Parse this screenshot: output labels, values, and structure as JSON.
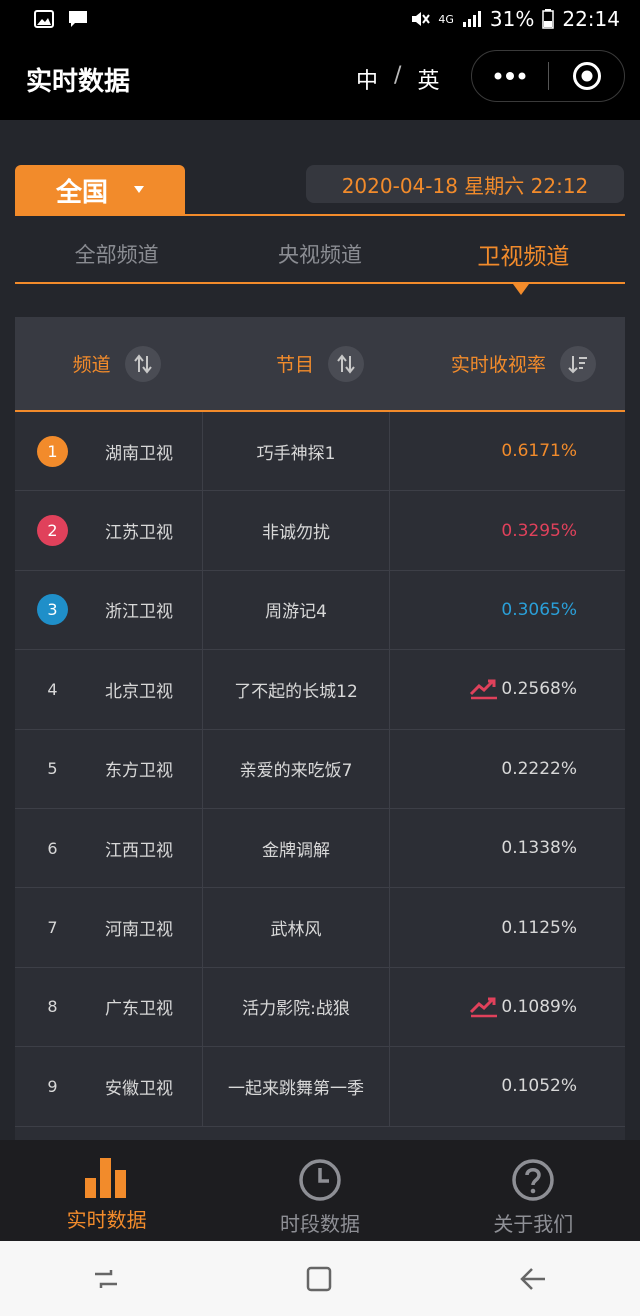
{
  "status_bar": {
    "network": "4G",
    "battery": "31%",
    "time": "22:14"
  },
  "header": {
    "title": "实时数据",
    "lang_zh": "中",
    "lang_sep": "/",
    "lang_en": "英"
  },
  "region": "全国",
  "datetime": "2020-04-18 星期六 22:12",
  "tabs": [
    {
      "label": "全部频道",
      "active": false
    },
    {
      "label": "央视频道",
      "active": false
    },
    {
      "label": "卫视频道",
      "active": true
    }
  ],
  "table": {
    "headers": [
      "频道",
      "节目",
      "实时收视率"
    ],
    "rows": [
      {
        "rank": "1",
        "channel": "湖南卫视",
        "program": "巧手神探1",
        "rate": "0.6171%",
        "rank_color": "#f28b2b",
        "rate_color": "#f28b2b",
        "trend": false
      },
      {
        "rank": "2",
        "channel": "江苏卫视",
        "program": "非诚勿扰",
        "rate": "0.3295%",
        "rank_color": "#e0415b",
        "rate_color": "#e0415b",
        "trend": false
      },
      {
        "rank": "3",
        "channel": "浙江卫视",
        "program": "周游记4",
        "rate": "0.3065%",
        "rank_color": "#1f8fc9",
        "rate_color": "#2a9fd8",
        "trend": false
      },
      {
        "rank": "4",
        "channel": "北京卫视",
        "program": "了不起的长城12",
        "rate": "0.2568%",
        "rank_color": "",
        "rate_color": "#d8d8d8",
        "trend": true
      },
      {
        "rank": "5",
        "channel": "东方卫视",
        "program": "亲爱的来吃饭7",
        "rate": "0.2222%",
        "rank_color": "",
        "rate_color": "#d8d8d8",
        "trend": false
      },
      {
        "rank": "6",
        "channel": "江西卫视",
        "program": "金牌调解",
        "rate": "0.1338%",
        "rank_color": "",
        "rate_color": "#d8d8d8",
        "trend": false
      },
      {
        "rank": "7",
        "channel": "河南卫视",
        "program": "武林风",
        "rate": "0.1125%",
        "rank_color": "",
        "rate_color": "#d8d8d8",
        "trend": false
      },
      {
        "rank": "8",
        "channel": "广东卫视",
        "program": "活力影院:战狼",
        "rate": "0.1089%",
        "rank_color": "",
        "rate_color": "#d8d8d8",
        "trend": true
      },
      {
        "rank": "9",
        "channel": "安徽卫视",
        "program": "一起来跳舞第一季",
        "rate": "0.1052%",
        "rank_color": "",
        "rate_color": "#d8d8d8",
        "trend": false
      }
    ]
  },
  "bottom_nav": [
    {
      "label": "实时数据",
      "icon": "bar-chart-icon",
      "active": true
    },
    {
      "label": "时段数据",
      "icon": "clock-icon",
      "active": false
    },
    {
      "label": "关于我们",
      "icon": "question-icon",
      "active": false
    }
  ],
  "colors": {
    "accent": "#f28b2b",
    "background": "#24262c"
  }
}
